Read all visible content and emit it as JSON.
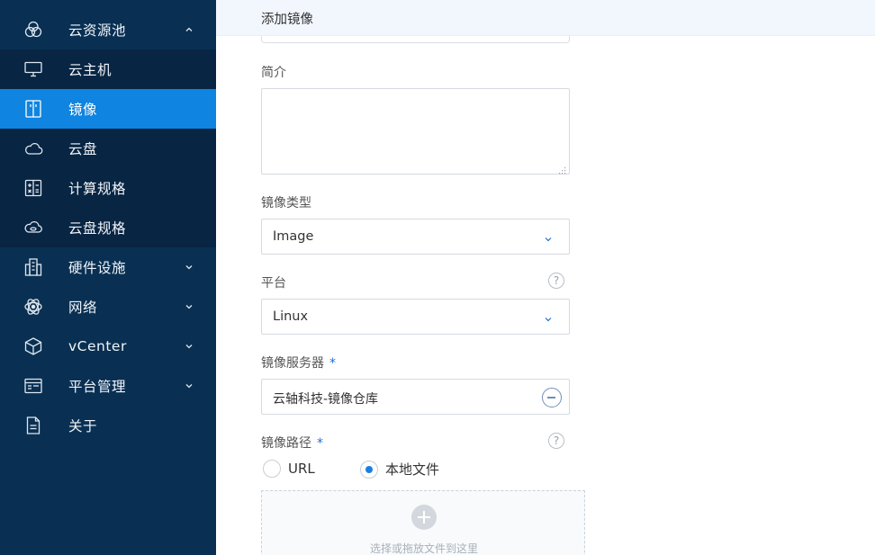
{
  "sidebar": {
    "items": [
      {
        "label": "云资源池",
        "icon": "cloud-pool-icon",
        "expanded": true
      },
      {
        "label": "云主机",
        "icon": "monitor-icon"
      },
      {
        "label": "镜像",
        "icon": "image-icon",
        "active": true
      },
      {
        "label": "云盘",
        "icon": "cloud-disk-icon"
      },
      {
        "label": "计算规格",
        "icon": "calculator-icon"
      },
      {
        "label": "云盘规格",
        "icon": "disk-spec-icon"
      },
      {
        "label": "硬件设施",
        "icon": "building-icon"
      },
      {
        "label": "网络",
        "icon": "network-icon"
      },
      {
        "label": "vCenter",
        "icon": "cube-icon"
      },
      {
        "label": "平台管理",
        "icon": "window-icon"
      },
      {
        "label": "关于",
        "icon": "document-icon"
      }
    ]
  },
  "header": {
    "title": "添加镜像"
  },
  "form": {
    "description_label": "简介",
    "description_value": "",
    "image_type_label": "镜像类型",
    "image_type_value": "Image",
    "platform_label": "平台",
    "platform_value": "Linux",
    "server_label": "镜像服务器",
    "server_value": "云轴科技-镜像仓库",
    "path_label": "镜像路径",
    "required_mark": "*",
    "help_glyph": "?",
    "path_options": [
      {
        "label": "URL",
        "checked": false
      },
      {
        "label": "本地文件",
        "checked": true
      }
    ],
    "upload_hint": "选择或拖放文件到这里"
  },
  "colors": {
    "sidebar_bg": "#093053",
    "sidebar_active": "#0f84e0",
    "accent": "#1a7ee3"
  }
}
